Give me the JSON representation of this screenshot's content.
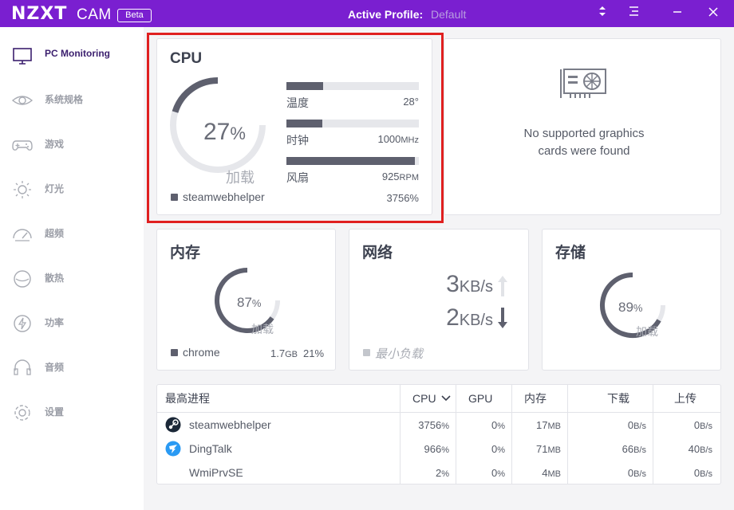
{
  "app": {
    "logo": "NZXT",
    "logo_suffix": "CAM",
    "beta": "Beta",
    "profile_label": "Active Profile:",
    "profile_value": "Default"
  },
  "sidebar": {
    "items": [
      {
        "label": "PC Monitoring",
        "icon": "monitor-icon",
        "active": true
      },
      {
        "label": "系统规格",
        "icon": "eye-icon"
      },
      {
        "label": "游戏",
        "icon": "gamepad-icon"
      },
      {
        "label": "灯光",
        "icon": "sun-icon"
      },
      {
        "label": "超频",
        "icon": "speedometer-icon"
      },
      {
        "label": "散热",
        "icon": "fan-icon"
      },
      {
        "label": "功率",
        "icon": "lightning-icon"
      },
      {
        "label": "音频",
        "icon": "headset-icon"
      },
      {
        "label": "设置",
        "icon": "gear-icon"
      }
    ]
  },
  "cpu": {
    "title": "CPU",
    "load_value": "27",
    "load_unit": "%",
    "load_label": "加载",
    "load_fraction": 0.27,
    "temp_label": "温度",
    "temp_value": "28°",
    "temp_fraction": 0.28,
    "clock_label": "时钟",
    "clock_value": "1000",
    "clock_unit": "MHz",
    "clock_fraction": 0.27,
    "fan_label": "风扇",
    "fan_value": "925",
    "fan_unit": "RPM",
    "fan_fraction": 0.97,
    "top_process": "steamwebhelper",
    "top_process_value": "3756%"
  },
  "gpu": {
    "message": "No supported graphics cards were found",
    "icon": "graphics-card-icon"
  },
  "memory": {
    "title": "内存",
    "load_value": "87",
    "load_unit": "%",
    "load_label": "加载",
    "load_fraction": 0.87,
    "top_process": "chrome",
    "top_process_size": "1.7",
    "top_process_size_unit": "GB",
    "top_process_percent": "21%"
  },
  "network": {
    "title": "网络",
    "up_value": "3",
    "up_unit": "KB/s",
    "down_value": "2",
    "down_unit": "KB/s",
    "status": "最小负载"
  },
  "storage": {
    "title": "存储",
    "load_value": "89",
    "load_unit": "%",
    "load_label": "加载",
    "load_fraction": 0.89
  },
  "processes": {
    "headers": {
      "name": "最高进程",
      "cpu": "CPU",
      "gpu": "GPU",
      "memory": "内存",
      "download": "下载",
      "upload": "上传"
    },
    "rows": [
      {
        "name": "steamwebhelper",
        "icon": "steam-icon",
        "cpu": "3756",
        "gpu": "0",
        "mem": "17",
        "down": "0",
        "up": "0"
      },
      {
        "name": "DingTalk",
        "icon": "dingtalk-icon",
        "cpu": "966",
        "gpu": "0",
        "mem": "71",
        "down": "66",
        "up": "40"
      },
      {
        "name": "WmiPrvSE",
        "icon": "",
        "cpu": "2",
        "gpu": "0",
        "mem": "4",
        "down": "0",
        "up": "0"
      }
    ],
    "pct_unit": "%",
    "mem_unit": "MB",
    "rate_unit": "B/s"
  },
  "colors": {
    "accent": "#7a1fd0",
    "gauge": "#5e606e",
    "track": "#e6e7eb",
    "highlight": "#e02020"
  }
}
